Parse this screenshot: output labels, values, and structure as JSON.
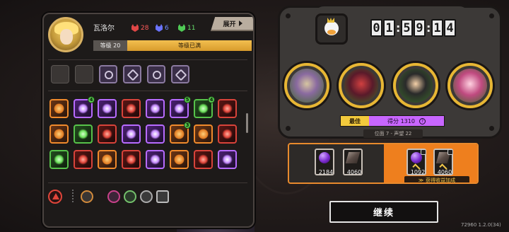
{
  "character": {
    "name": "瓦洛尔",
    "level_label": "等级 20",
    "level_status": "等级已满",
    "stats": [
      {
        "icon": "red-mask-icon",
        "value": "28",
        "color": "#e04747"
      },
      {
        "icon": "blue-mask-icon",
        "value": "6",
        "color": "#6a73ff"
      },
      {
        "icon": "green-mask-icon",
        "value": "11",
        "color": "#4fca55"
      }
    ]
  },
  "expand_button": {
    "label": "展开"
  },
  "inventory": {
    "slot_rows": [
      [
        "empty",
        "empty",
        "passive",
        "passive",
        "passive",
        "passive"
      ]
    ],
    "card_rows": [
      [
        "orange",
        "purple",
        "purple",
        "red",
        "purple",
        "purple",
        "green",
        "red"
      ],
      [
        "orange",
        "green",
        "red",
        "purple",
        "purple",
        "orange",
        "orange",
        "red"
      ],
      [
        "green",
        "red",
        "orange",
        "red",
        "purple",
        "orange",
        "red",
        "purple"
      ]
    ],
    "badges": [
      {
        "row": 0,
        "col": 1,
        "value": "4"
      },
      {
        "row": 0,
        "col": 5,
        "value": "5"
      },
      {
        "row": 0,
        "col": 6,
        "value": "4"
      },
      {
        "row": 1,
        "col": 5,
        "value": "3"
      }
    ]
  },
  "timer": {
    "digits": [
      "0",
      "1",
      "5",
      "9",
      "1",
      "4"
    ]
  },
  "bosses": [
    {
      "icon": "insect-mask-boss-icon"
    },
    {
      "icon": "demon-knight-boss-icon"
    },
    {
      "icon": "scientist-boss-icon"
    },
    {
      "icon": "pink-flower-boss-icon"
    }
  ],
  "score": {
    "best_label": "最佳",
    "score_text": "得分 1310",
    "rank_text": "位面 7 - 声望 22"
  },
  "rewards": {
    "left": [
      {
        "icon": "purple-orb-icon",
        "count": "2184"
      },
      {
        "icon": "plank-icon",
        "count": "4060"
      }
    ],
    "right": [
      {
        "icon": "purple-orb-icon",
        "count": "1092"
      },
      {
        "icon": "plank-icon",
        "count": "4060"
      }
    ],
    "bonus_label": "获得收益加成"
  },
  "continue_button": {
    "label": "继续"
  },
  "version": "72960 1.2.0(34)"
}
